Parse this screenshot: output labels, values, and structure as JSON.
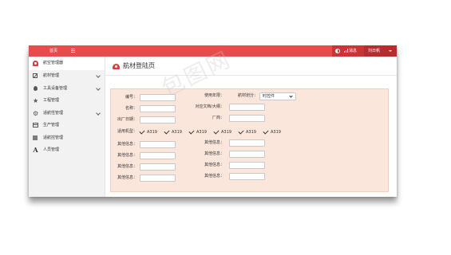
{
  "topbar": {
    "home_label": "首页",
    "message_label": "消息",
    "user_label": "刘日帆",
    "accent_color": "#e84b4b"
  },
  "sidebar": {
    "items": [
      {
        "label": "航空管理器",
        "icon": "gauge-icon",
        "expandable": false
      },
      {
        "label": "航材管理",
        "icon": "edit-icon",
        "expandable": true
      },
      {
        "label": "工具设备管理",
        "icon": "drop-icon",
        "expandable": true
      },
      {
        "label": "工程管理",
        "icon": "star-icon",
        "expandable": false
      },
      {
        "label": "适航性管理",
        "icon": "gears-icon",
        "expandable": true
      },
      {
        "label": "生产管理",
        "icon": "grid-icon",
        "expandable": false
      },
      {
        "label": "适航控管理",
        "icon": "dots-grid-icon",
        "expandable": false
      },
      {
        "label": "人员管理",
        "icon": "font-icon",
        "expandable": false
      }
    ]
  },
  "page": {
    "title": "航材登陆页"
  },
  "form": {
    "left": {
      "number": {
        "label": "编号：",
        "value": ""
      },
      "name": {
        "label": "名称：",
        "value": ""
      },
      "manufacture_date": {
        "label": "出厂日期：",
        "value": ""
      }
    },
    "right": {
      "usage_years": {
        "label": "使用年限：",
        "value": ""
      },
      "classification": {
        "label": "航材划分：",
        "selected": "时控件"
      },
      "matching_doc": {
        "label": "对应文档/大纲：",
        "value": ""
      },
      "manufacturer": {
        "label": "厂商：",
        "value": ""
      }
    },
    "models_label": "适用机型：",
    "models": [
      "A319",
      "A319",
      "A319",
      "A319",
      "A319",
      "A319"
    ],
    "other_label": "其他信息：",
    "other_left": [
      "",
      "",
      "",
      ""
    ],
    "other_right": [
      "",
      "",
      "",
      ""
    ]
  },
  "watermark": "包图网"
}
